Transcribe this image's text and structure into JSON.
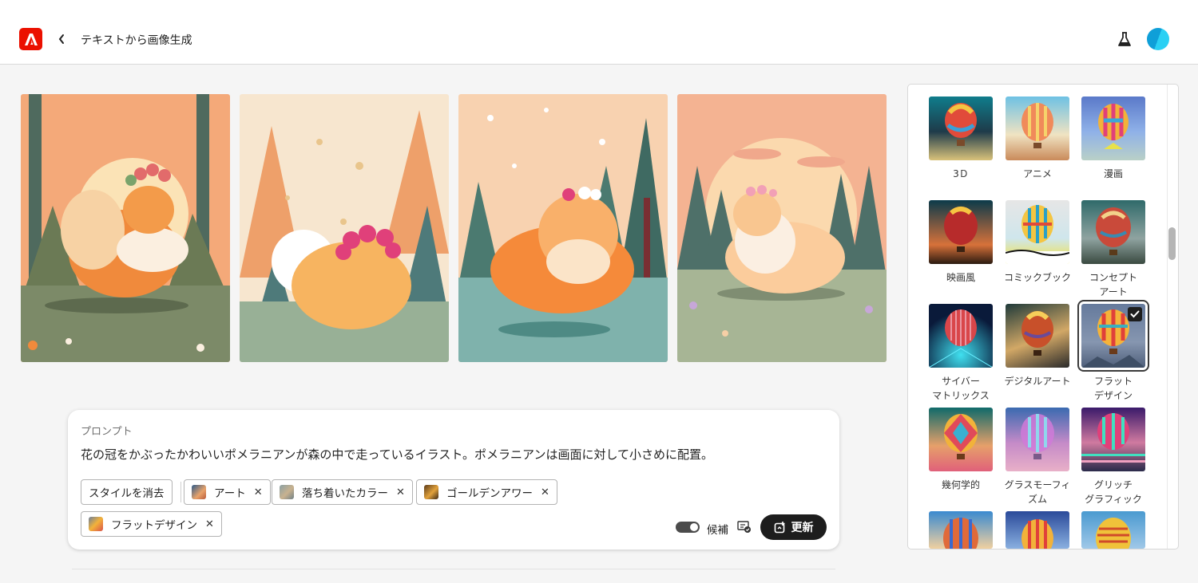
{
  "header": {
    "title": "テキストから画像生成"
  },
  "prompt": {
    "label": "プロンプト",
    "text": "花の冠をかぶったかわいいポメラニアンが森の中で走っているイラスト。ポメラニアンは画面に対して小さめに配置。",
    "clear_style": "スタイルを消去",
    "chips": [
      {
        "label": "アート"
      },
      {
        "label": "落ち着いたカラー"
      },
      {
        "label": "ゴールデンアワー"
      },
      {
        "label": "フラットデザイン"
      }
    ],
    "toggle_label": "候補",
    "update_label": "更新"
  },
  "styles": [
    {
      "label": "3Ｄ"
    },
    {
      "label": "アニメ"
    },
    {
      "label": "漫画"
    },
    {
      "label": "映画風"
    },
    {
      "label": "コミックブック"
    },
    {
      "label": "コンセプト\nアート"
    },
    {
      "label": "サイバー\nマトリックス"
    },
    {
      "label": "デジタルアート"
    },
    {
      "label": "フラット\nデザイン",
      "selected": true
    },
    {
      "label": "幾何学的"
    },
    {
      "label": "グラスモーフィ\nズム"
    },
    {
      "label": "グリッチ\nグラフィック"
    },
    {
      "label": ""
    },
    {
      "label": ""
    },
    {
      "label": ""
    }
  ],
  "colors": {
    "accent_logo": "#eb1000",
    "button_dark": "#1d1d1d"
  }
}
